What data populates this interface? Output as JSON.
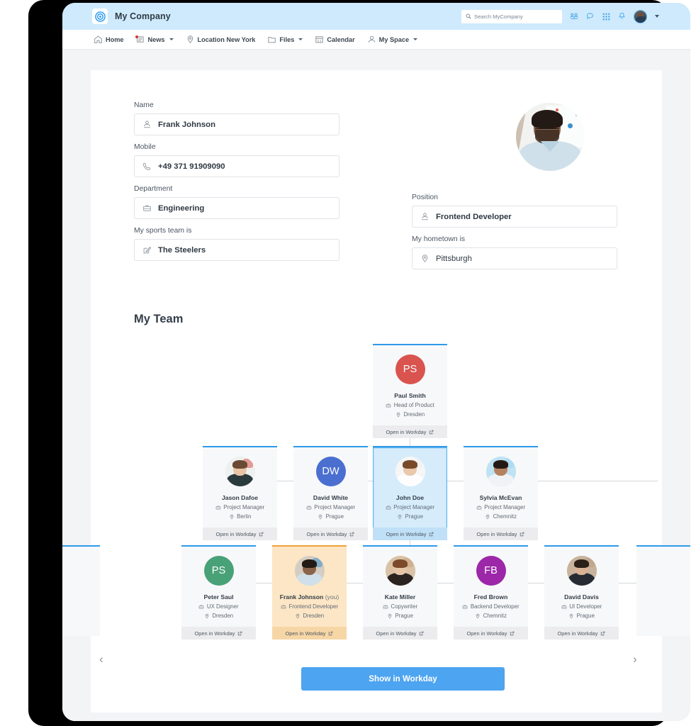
{
  "header": {
    "brand": "My Company",
    "logo_icon": "target-circle-icon",
    "bg_color": "#cfeafc",
    "search": {
      "placeholder": "Search MyCompany",
      "value": "",
      "icon": "search-icon"
    },
    "icons": [
      {
        "name": "people-directory-icon",
        "glyph": "people"
      },
      {
        "name": "chat-bubble-icon",
        "glyph": "chat"
      },
      {
        "name": "apps-grid-icon",
        "glyph": "grid"
      },
      {
        "name": "bell-notifications-icon",
        "glyph": "bell"
      }
    ],
    "avatar": {
      "name": "user-avatar",
      "caret": "chevron-down-icon"
    }
  },
  "nav": {
    "items": [
      {
        "label": "Home",
        "icon": "home-icon",
        "caret": false,
        "badge": false
      },
      {
        "label": "News",
        "icon": "news-icon",
        "caret": true,
        "badge": true
      },
      {
        "label": "Location New York",
        "icon": "location-pin-icon",
        "caret": false,
        "badge": false
      },
      {
        "label": "Files",
        "icon": "folder-icon",
        "caret": true,
        "badge": false
      },
      {
        "label": "Calendar",
        "icon": "calendar-icon",
        "caret": false,
        "badge": false
      },
      {
        "label": "My Space",
        "icon": "person-icon",
        "caret": true,
        "badge": false
      }
    ]
  },
  "profile": {
    "fields_left": [
      {
        "label": "Name",
        "value": "Frank Johnson",
        "icon": "person-badge-icon",
        "bold": true
      },
      {
        "label": "Mobile",
        "value": "+49 371 91909090",
        "icon": "phone-icon",
        "bold": true
      },
      {
        "label": "Department",
        "value": "Engineering",
        "icon": "briefcase-icon",
        "bold": true
      },
      {
        "label": "My sports team is",
        "value": "The Steelers",
        "icon": "pencil-square-icon",
        "bold": true
      }
    ],
    "fields_right": [
      {
        "label": "Position",
        "value": "Frontend Developer",
        "icon": "person-badge-icon",
        "bold": true
      },
      {
        "label": "My hometown is",
        "value": "Pittsburgh",
        "icon": "location-pin-icon",
        "bold": true
      }
    ],
    "photo_alt": "profile-photo"
  },
  "team": {
    "title": "My Team",
    "open_label": "Open in Workday",
    "open_icon": "external-link-icon",
    "role_icon": "briefcase-icon",
    "location_icon": "location-pin-icon",
    "prev_icon": "chevron-left-icon",
    "next_icon": "chevron-right-icon",
    "show_button": "Show in Workday",
    "accent_color": "#2f9ae8",
    "you_color": "#f0a23c",
    "levels": [
      {
        "cards": [
          {
            "name": "Paul Smith",
            "role": "Head of Product",
            "location": "Dresden",
            "initials": "PS",
            "avatar_type": "initials",
            "avatar_color": "#d9534f",
            "state": "normal",
            "suffix": ""
          }
        ]
      },
      {
        "cards": [
          {
            "name": "Jason Dafoe",
            "role": "Project Manager",
            "location": "Berlin",
            "initials": "JD",
            "avatar_type": "photo",
            "avatar_color": "#e6e8ea",
            "state": "normal",
            "suffix": ""
          },
          {
            "name": "David White",
            "role": "Project Manager",
            "location": "Prague",
            "initials": "DW",
            "avatar_type": "initials",
            "avatar_color": "#4a6fd0",
            "state": "normal",
            "suffix": ""
          },
          {
            "name": "John Doe",
            "role": "Project Manager",
            "location": "Prague",
            "initials": "JD",
            "avatar_type": "photo",
            "avatar_color": "#f3f3f3",
            "state": "selected",
            "suffix": ""
          },
          {
            "name": "Sylvia McEvan",
            "role": "Project Manager",
            "location": "Chemnitz",
            "initials": "SM",
            "avatar_type": "photo",
            "avatar_color": "#bfe2f2",
            "state": "normal",
            "suffix": ""
          }
        ]
      },
      {
        "cards": [
          {
            "name": "Peter Saul",
            "role": "UX Designer",
            "location": "Dresden",
            "initials": "PS",
            "avatar_type": "initials",
            "avatar_color": "#49a178",
            "state": "normal",
            "suffix": ""
          },
          {
            "name": "Frank Johnson",
            "role": "Frontend Developer",
            "location": "Dresden",
            "initials": "FJ",
            "avatar_type": "photo",
            "avatar_color": "#d9cfc4",
            "state": "you",
            "suffix": "(you)"
          },
          {
            "name": "Kate Miller",
            "role": "Copywriter",
            "location": "Prague",
            "initials": "KM",
            "avatar_type": "photo",
            "avatar_color": "#d8c3ac",
            "state": "normal",
            "suffix": ""
          },
          {
            "name": "Fred Brown",
            "role": "Backend Developer",
            "location": "Chemnitz",
            "initials": "FB",
            "avatar_type": "initials",
            "avatar_color": "#9c27a8",
            "state": "normal",
            "suffix": ""
          },
          {
            "name": "David Davis",
            "role": "UI Developer",
            "location": "Prague",
            "initials": "DD",
            "avatar_type": "photo",
            "avatar_color": "#cbb49e",
            "state": "normal",
            "suffix": ""
          }
        ]
      }
    ]
  }
}
